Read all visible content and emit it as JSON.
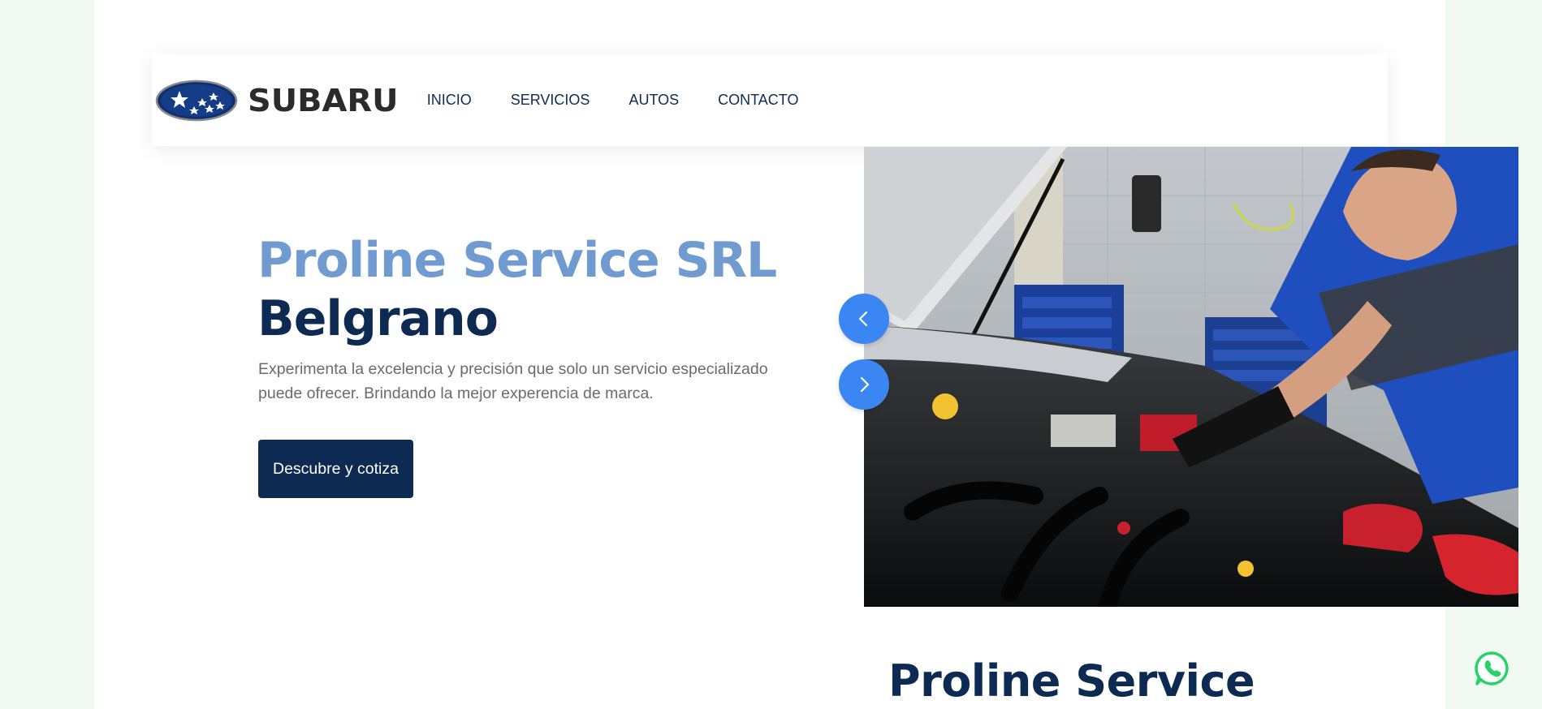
{
  "header": {
    "logo_text": "SUBARU",
    "nav": [
      {
        "label": "INICIO"
      },
      {
        "label": "SERVICIOS"
      },
      {
        "label": "AUTOS"
      },
      {
        "label": "CONTACTO"
      }
    ]
  },
  "hero": {
    "title_line1": "Proline Service SRL",
    "title_line2": "Belgrano",
    "description": "Experimenta la excelencia y precisión que solo un servicio especializado puede ofrecer. Brindando la mejor experencia de marca.",
    "cta_label": "Descubre y cotiza",
    "carousel": {
      "prev_icon": "chevron-left-icon",
      "next_icon": "chevron-right-icon"
    }
  },
  "section": {
    "title": "Proline Service"
  },
  "floating": {
    "icon": "whatsapp-icon"
  },
  "colors": {
    "primary": "#0d2b52",
    "accent_light": "#6f9bd0",
    "carousel_button": "#3b86f2",
    "whatsapp": "#25d366",
    "outer_background": "#f0faf3"
  }
}
